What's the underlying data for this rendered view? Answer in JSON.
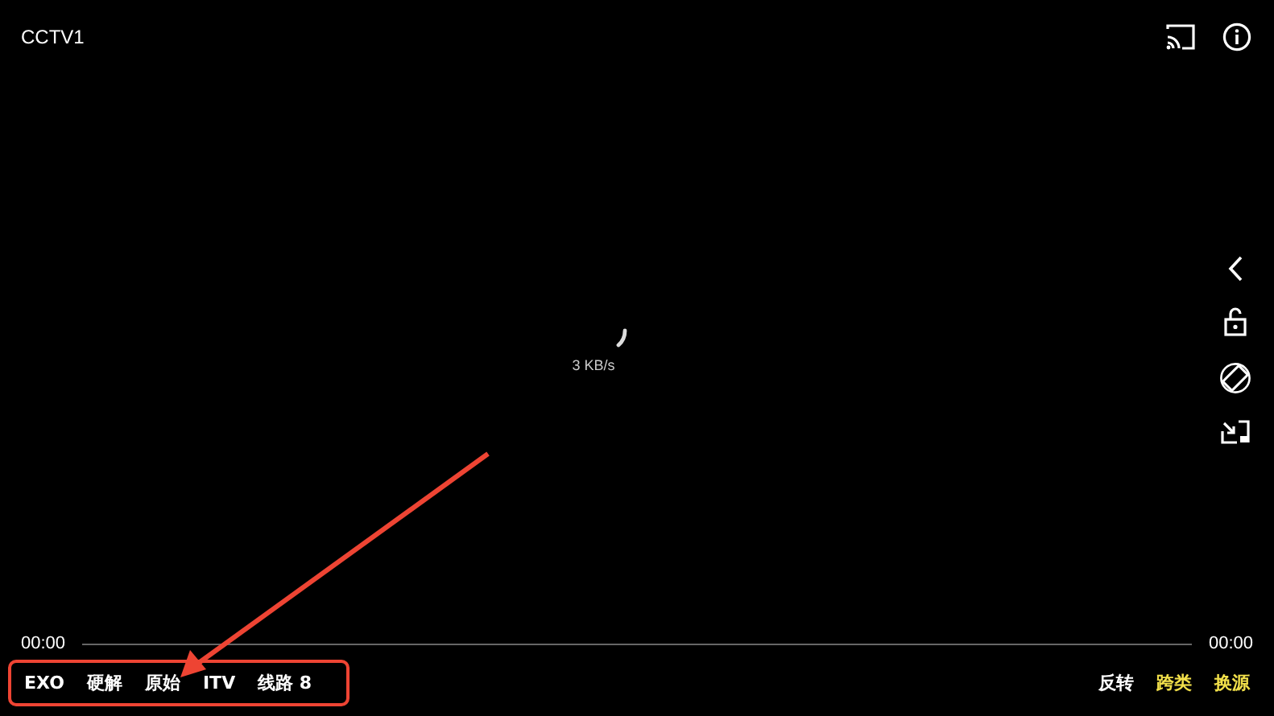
{
  "title": "CCTV1",
  "speed": "3 KB/s",
  "progress": {
    "current": "00:00",
    "total": "00:00"
  },
  "left_buttons": [
    {
      "label": "EXO"
    },
    {
      "label": "硬解"
    },
    {
      "label": "原始"
    },
    {
      "label": "ITV"
    },
    {
      "label": "线路 8"
    }
  ],
  "right_buttons": [
    {
      "label": "反转",
      "highlighted": false
    },
    {
      "label": "跨类",
      "highlighted": true
    },
    {
      "label": "换源",
      "highlighted": true
    }
  ]
}
